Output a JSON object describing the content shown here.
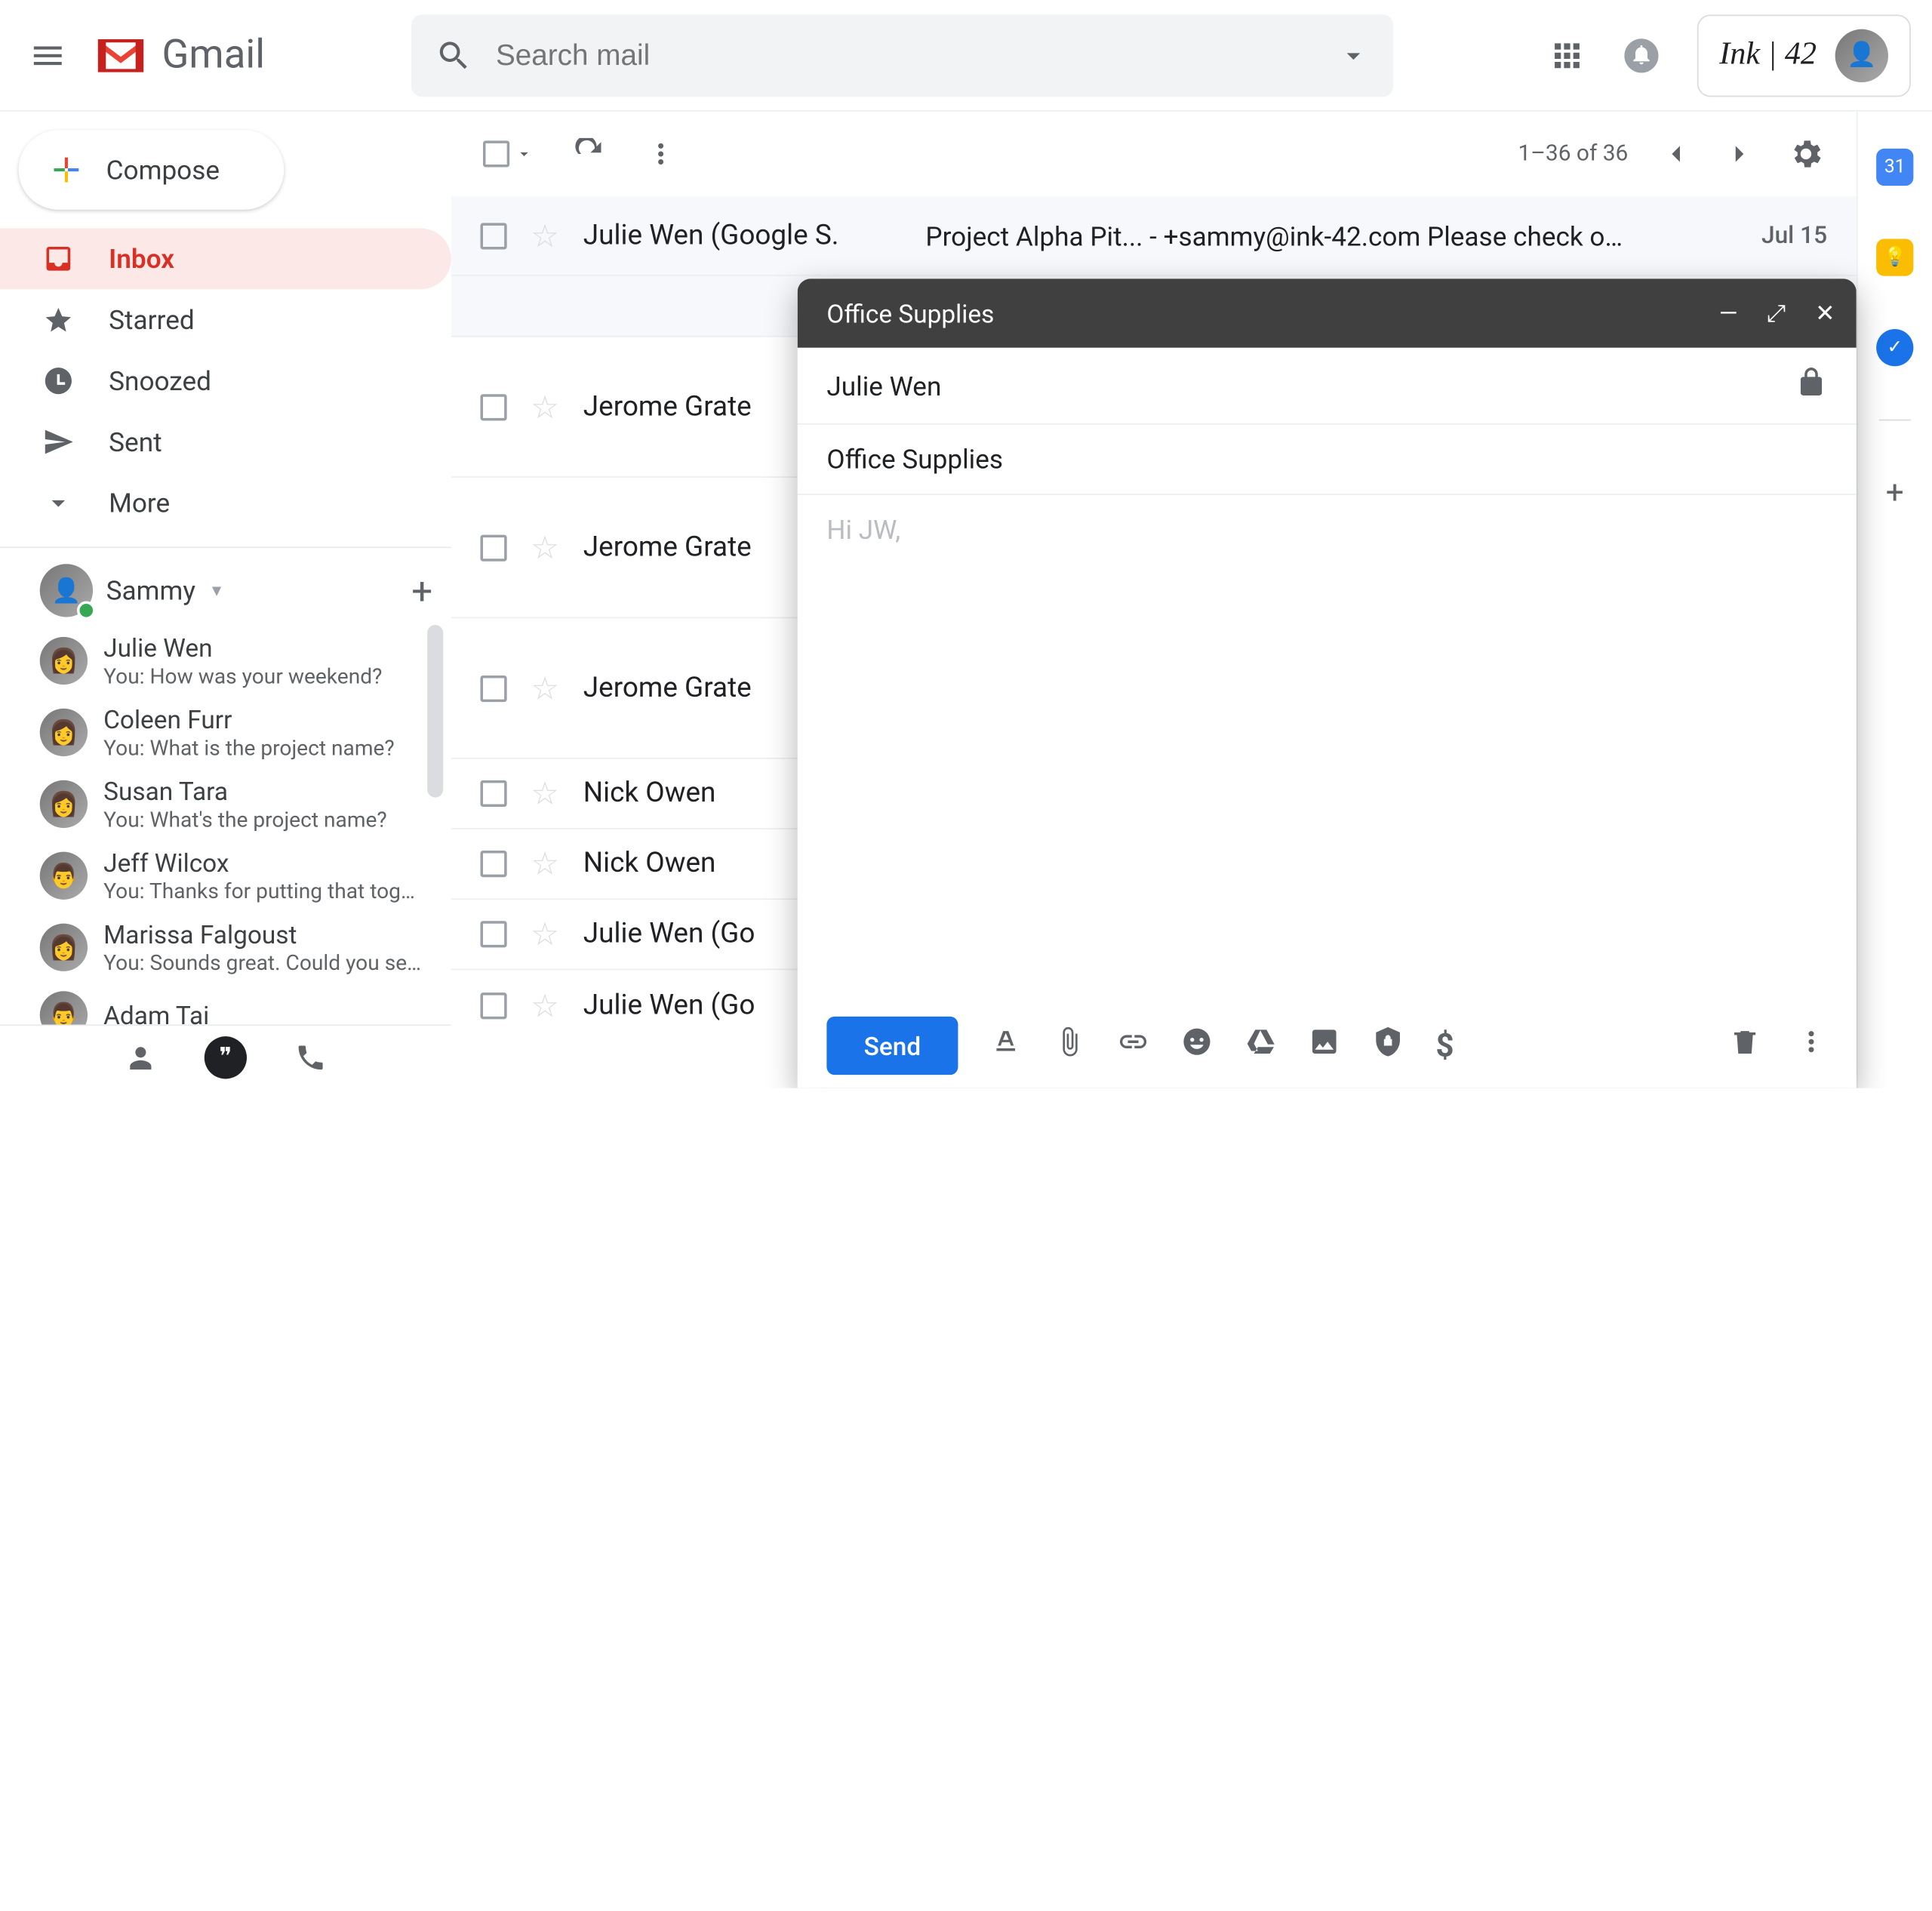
{
  "header": {
    "app_name": "Gmail",
    "search_placeholder": "Search mail",
    "brand": "Ink | 42"
  },
  "sidebar": {
    "compose_label": "Compose",
    "items": [
      {
        "label": "Inbox",
        "icon": "inbox-icon",
        "active": true
      },
      {
        "label": "Starred",
        "icon": "star-icon"
      },
      {
        "label": "Snoozed",
        "icon": "clock-icon"
      },
      {
        "label": "Sent",
        "icon": "send-icon"
      },
      {
        "label": "More",
        "icon": "chevron-down-icon"
      }
    ],
    "chat_user": "Sammy",
    "chats": [
      {
        "name": "Julie Wen",
        "preview": "You: How was your weekend?"
      },
      {
        "name": "Coleen Furr",
        "preview": "You: What is the project name?"
      },
      {
        "name": "Susan Tara",
        "preview": "You: What's the project name?"
      },
      {
        "name": "Jeff Wilcox",
        "preview": "You: Thanks for putting that togeth"
      },
      {
        "name": "Marissa Falgoust",
        "preview": "You: Sounds great. Could you send"
      },
      {
        "name": "Adam Tai",
        "preview": ""
      }
    ]
  },
  "toolbar": {
    "pagination": "1–36 of 36"
  },
  "emails": [
    {
      "sender": "Julie Wen (Google S.",
      "subject": "Project Alpha Pit... - +sammy@ink-42.com Please check o…",
      "date": "Jul 15"
    },
    {
      "sender": "Jerome Grate",
      "subject": ""
    },
    {
      "sender": "Jerome Grate",
      "subject": ""
    },
    {
      "sender": "Jerome Grate",
      "subject": ""
    },
    {
      "sender": "Nick Owen",
      "subject": ""
    },
    {
      "sender": "Nick Owen",
      "subject": ""
    },
    {
      "sender": "Julie Wen (Go",
      "subject": ""
    },
    {
      "sender": "Julie Wen (Go",
      "subject": ""
    }
  ],
  "compose": {
    "title": "Office Supplies",
    "to": "Julie Wen",
    "subject": "Office Supplies",
    "body_placeholder": "Hi JW,",
    "send_label": "Send"
  },
  "icons": {
    "menu": "menu-icon",
    "search": "search-icon",
    "dropdown": "chevron-down-icon",
    "apps": "apps-grid-icon",
    "notifications": "bell-icon",
    "refresh": "refresh-icon",
    "more": "more-vert-icon",
    "settings": "gear-icon",
    "prev": "chevron-left-icon",
    "next": "chevron-right-icon",
    "checkbox": "checkbox-icon",
    "star": "star-outline-icon",
    "minimize": "minimize-icon",
    "expand": "expand-icon",
    "close": "close-icon",
    "lock": "lock-icon",
    "format": "text-format-icon",
    "attach": "attach-icon",
    "link": "link-icon",
    "emoji": "emoji-icon",
    "drive": "drive-icon",
    "photo": "photo-icon",
    "confidential": "confidential-icon",
    "money": "dollar-icon",
    "trash": "trash-icon",
    "person": "person-icon",
    "hangouts": "hangouts-icon",
    "phone": "phone-icon",
    "calendar": "calendar-icon",
    "keep": "keep-icon",
    "tasks": "tasks-icon",
    "plus": "plus-icon"
  }
}
